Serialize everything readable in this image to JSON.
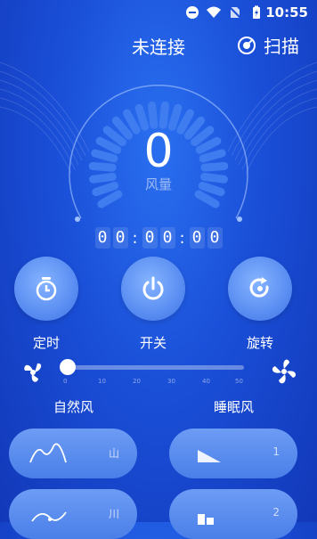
{
  "status_bar": {
    "time": "10:55",
    "icons": [
      "do-not-disturb-icon",
      "wifi-icon",
      "no-sim-icon",
      "battery-charging-icon"
    ]
  },
  "header": {
    "title": "未连接",
    "scan_label": "扫描"
  },
  "speed": {
    "value": "0",
    "label": "风量"
  },
  "timer": {
    "digits": [
      "0",
      "0",
      "0",
      "0",
      "0",
      "0"
    ]
  },
  "controls": {
    "timer_label": "定时",
    "power_label": "开关",
    "rotate_label": "旋转"
  },
  "slider": {
    "value": 0,
    "ticks": [
      "0",
      "10",
      "20",
      "30",
      "40",
      "50"
    ]
  },
  "modes": {
    "natural_label": "自然风",
    "sleep_label": "睡眠风",
    "natural_items": [
      "山",
      "川"
    ],
    "sleep_items": [
      "1",
      "2"
    ]
  },
  "colors": {
    "background": "#1a4fd8",
    "button": "#5e91f3",
    "card": "#5a8cee"
  }
}
